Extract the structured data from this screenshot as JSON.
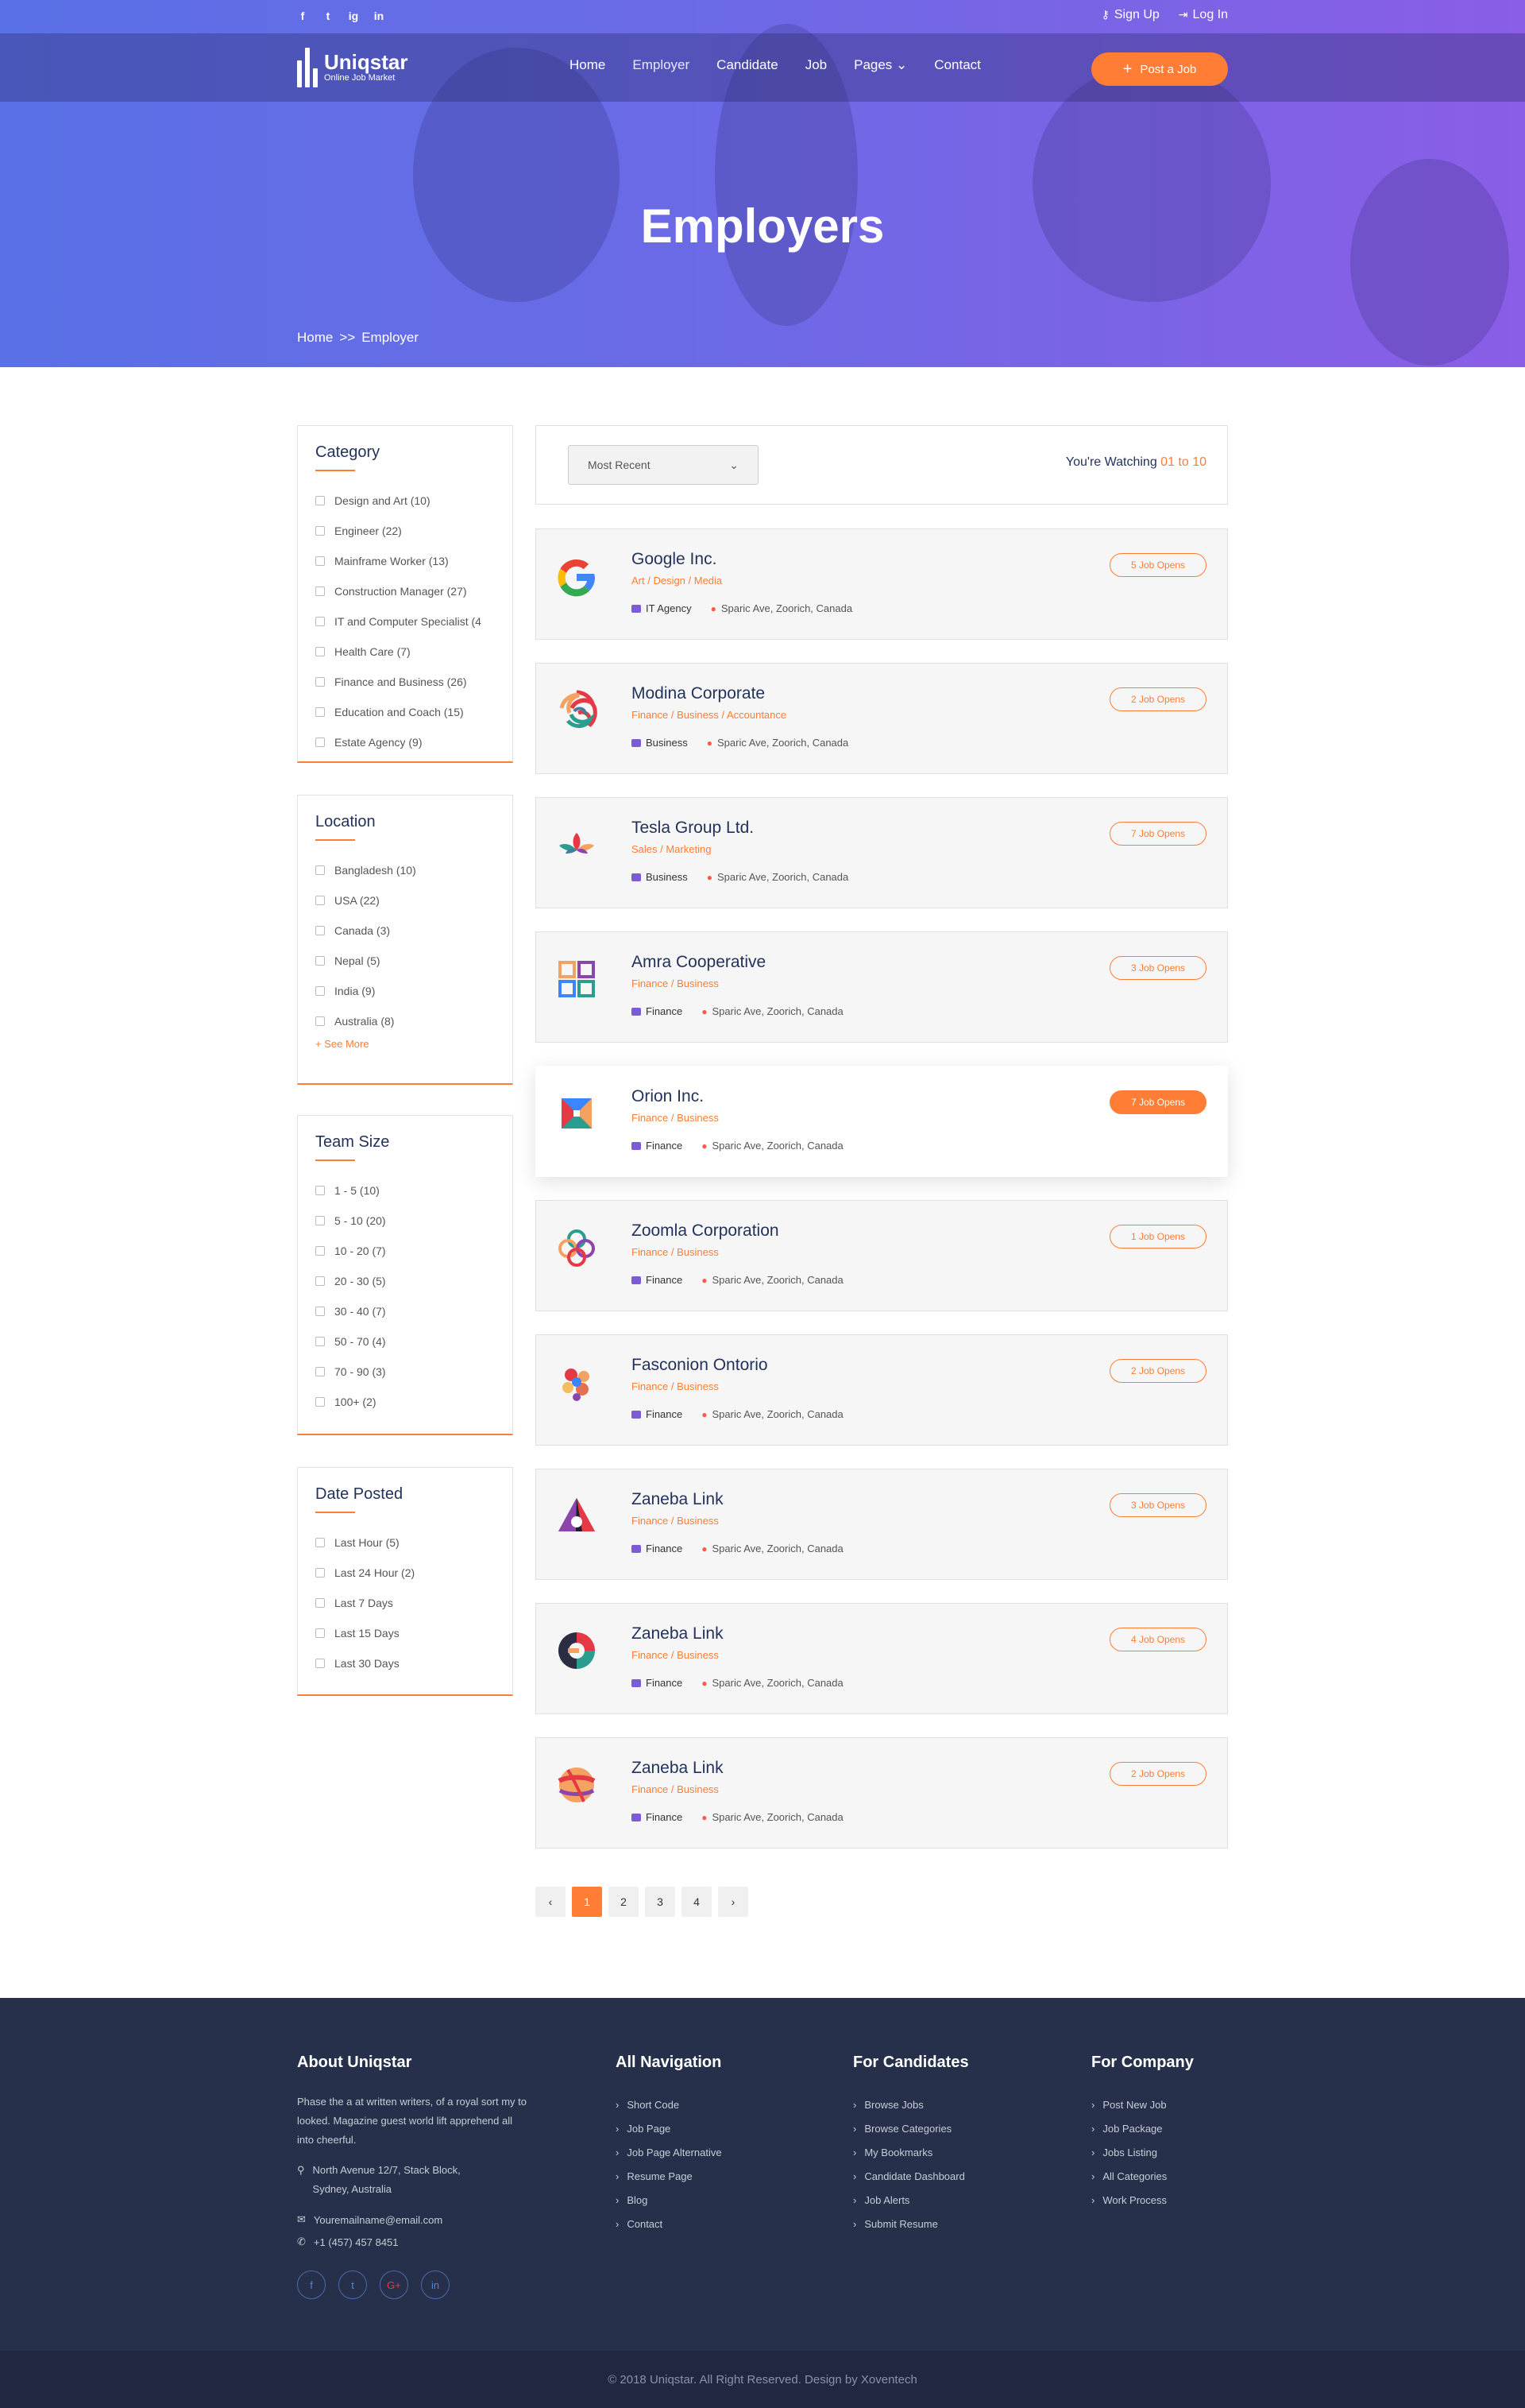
{
  "topbar": {
    "social": [
      "f",
      "t",
      "ig",
      "in"
    ],
    "signup": "Sign Up",
    "login": "Log In"
  },
  "nav": {
    "logo_name": "Uniqstar",
    "logo_sub": "Online Job Market",
    "items": [
      "Home",
      "Employer",
      "Candidate",
      "Job",
      "Pages",
      "Contact"
    ],
    "post_job": "Post a Job"
  },
  "hero": {
    "title": "Employers",
    "breadcrumb": [
      "Home",
      ">>",
      "Employer"
    ]
  },
  "sidebar": {
    "category": {
      "title": "Category",
      "items": [
        "Design and Art (10)",
        "Engineer (22)",
        "Mainframe Worker (13)",
        "Construction Manager (27)",
        "IT and Computer Specialist (4",
        "Health Care (7)",
        "Finance and Business (26)",
        "Education and Coach (15)",
        "Estate Agency (9)"
      ]
    },
    "location": {
      "title": "Location",
      "items": [
        "Bangladesh (10)",
        "USA (22)",
        "Canada (3)",
        "Nepal (5)",
        "India (9)",
        "Australia (8)"
      ],
      "see_more": "+ See More"
    },
    "team_size": {
      "title": "Team Size",
      "items": [
        "1 - 5 (10)",
        "5 - 10 (20)",
        "10 - 20 (7)",
        "20 - 30 (5)",
        "30 - 40 (7)",
        "50 - 70 (4)",
        "70 - 90 (3)",
        "100+ (2)"
      ]
    },
    "date_posted": {
      "title": "Date Posted",
      "items": [
        "Last Hour (5)",
        "Last 24 Hour (2)",
        "Last 7 Days",
        "Last 15 Days",
        "Last 30 Days"
      ]
    }
  },
  "sort": {
    "selected": "Most Recent",
    "watching_label": "You're Watching",
    "watching_range": "01 to 10"
  },
  "employers": [
    {
      "name": "Google Inc.",
      "category": "Art / Design / Media",
      "type": "IT Agency",
      "location": "Sparic Ave, Zoorich, Canada",
      "opens": "5 Job Opens"
    },
    {
      "name": "Modina Corporate",
      "category": "Finance / Business / Accountance",
      "type": "Business",
      "location": "Sparic Ave, Zoorich, Canada",
      "opens": "2 Job Opens"
    },
    {
      "name": "Tesla Group Ltd.",
      "category": "Sales / Marketing",
      "type": "Business",
      "location": "Sparic Ave, Zoorich, Canada",
      "opens": "7 Job Opens"
    },
    {
      "name": "Amra Cooperative",
      "category": "Finance / Business",
      "type": "Finance",
      "location": "Sparic Ave, Zoorich, Canada",
      "opens": "3 Job Opens"
    },
    {
      "name": "Orion Inc.",
      "category": "Finance / Business",
      "type": "Finance",
      "location": "Sparic Ave, Zoorich, Canada",
      "opens": "7 Job Opens"
    },
    {
      "name": "Zoomla Corporation",
      "category": "Finance / Business",
      "type": "Finance",
      "location": "Sparic Ave, Zoorich, Canada",
      "opens": "1 Job Opens"
    },
    {
      "name": "Fasconion Ontorio",
      "category": "Finance / Business",
      "type": "Finance",
      "location": "Sparic Ave, Zoorich, Canada",
      "opens": "2 Job Opens"
    },
    {
      "name": "Zaneba Link",
      "category": "Finance / Business",
      "type": "Finance",
      "location": "Sparic Ave, Zoorich, Canada",
      "opens": "3 Job Opens"
    },
    {
      "name": "Zaneba Link",
      "category": "Finance / Business",
      "type": "Finance",
      "location": "Sparic Ave, Zoorich, Canada",
      "opens": "4 Job Opens"
    },
    {
      "name": "Zaneba Link",
      "category": "Finance / Business",
      "type": "Finance",
      "location": "Sparic Ave, Zoorich, Canada",
      "opens": "2 Job Opens"
    }
  ],
  "pagination": {
    "prev": "‹",
    "pages": [
      "1",
      "2",
      "3",
      "4"
    ],
    "next": "›"
  },
  "footer": {
    "about": {
      "title": "About Uniqstar",
      "text": "Phase the a at written writers, of a royal sort my to looked. Magazine guest world lift apprehend all into cheerful.",
      "address_line1": "North Avenue 12/7, Stack Block,",
      "address_line2": "Sydney, Australia",
      "email": "Youremailname@email.com",
      "phone": "+1 (457) 457 8451",
      "social": [
        "f",
        "t",
        "G+",
        "in"
      ]
    },
    "navigation": {
      "title": "All Navigation",
      "links": [
        "Short Code",
        "Job Page",
        "Job Page Alternative",
        "Resume Page",
        "Blog",
        "Contact"
      ]
    },
    "candidates": {
      "title": "For Candidates",
      "links": [
        "Browse Jobs",
        "Browse Categories",
        "My Bookmarks",
        "Candidate Dashboard",
        "Job Alerts",
        "Submit Resume"
      ]
    },
    "company": {
      "title": "For Company",
      "links": [
        "Post New Job",
        "Job Package",
        "Jobs Listing",
        "All Categories",
        "Work Process"
      ]
    },
    "copyright": "© 2018 Uniqstar. All Right Reserved. Design by Xoventech"
  }
}
